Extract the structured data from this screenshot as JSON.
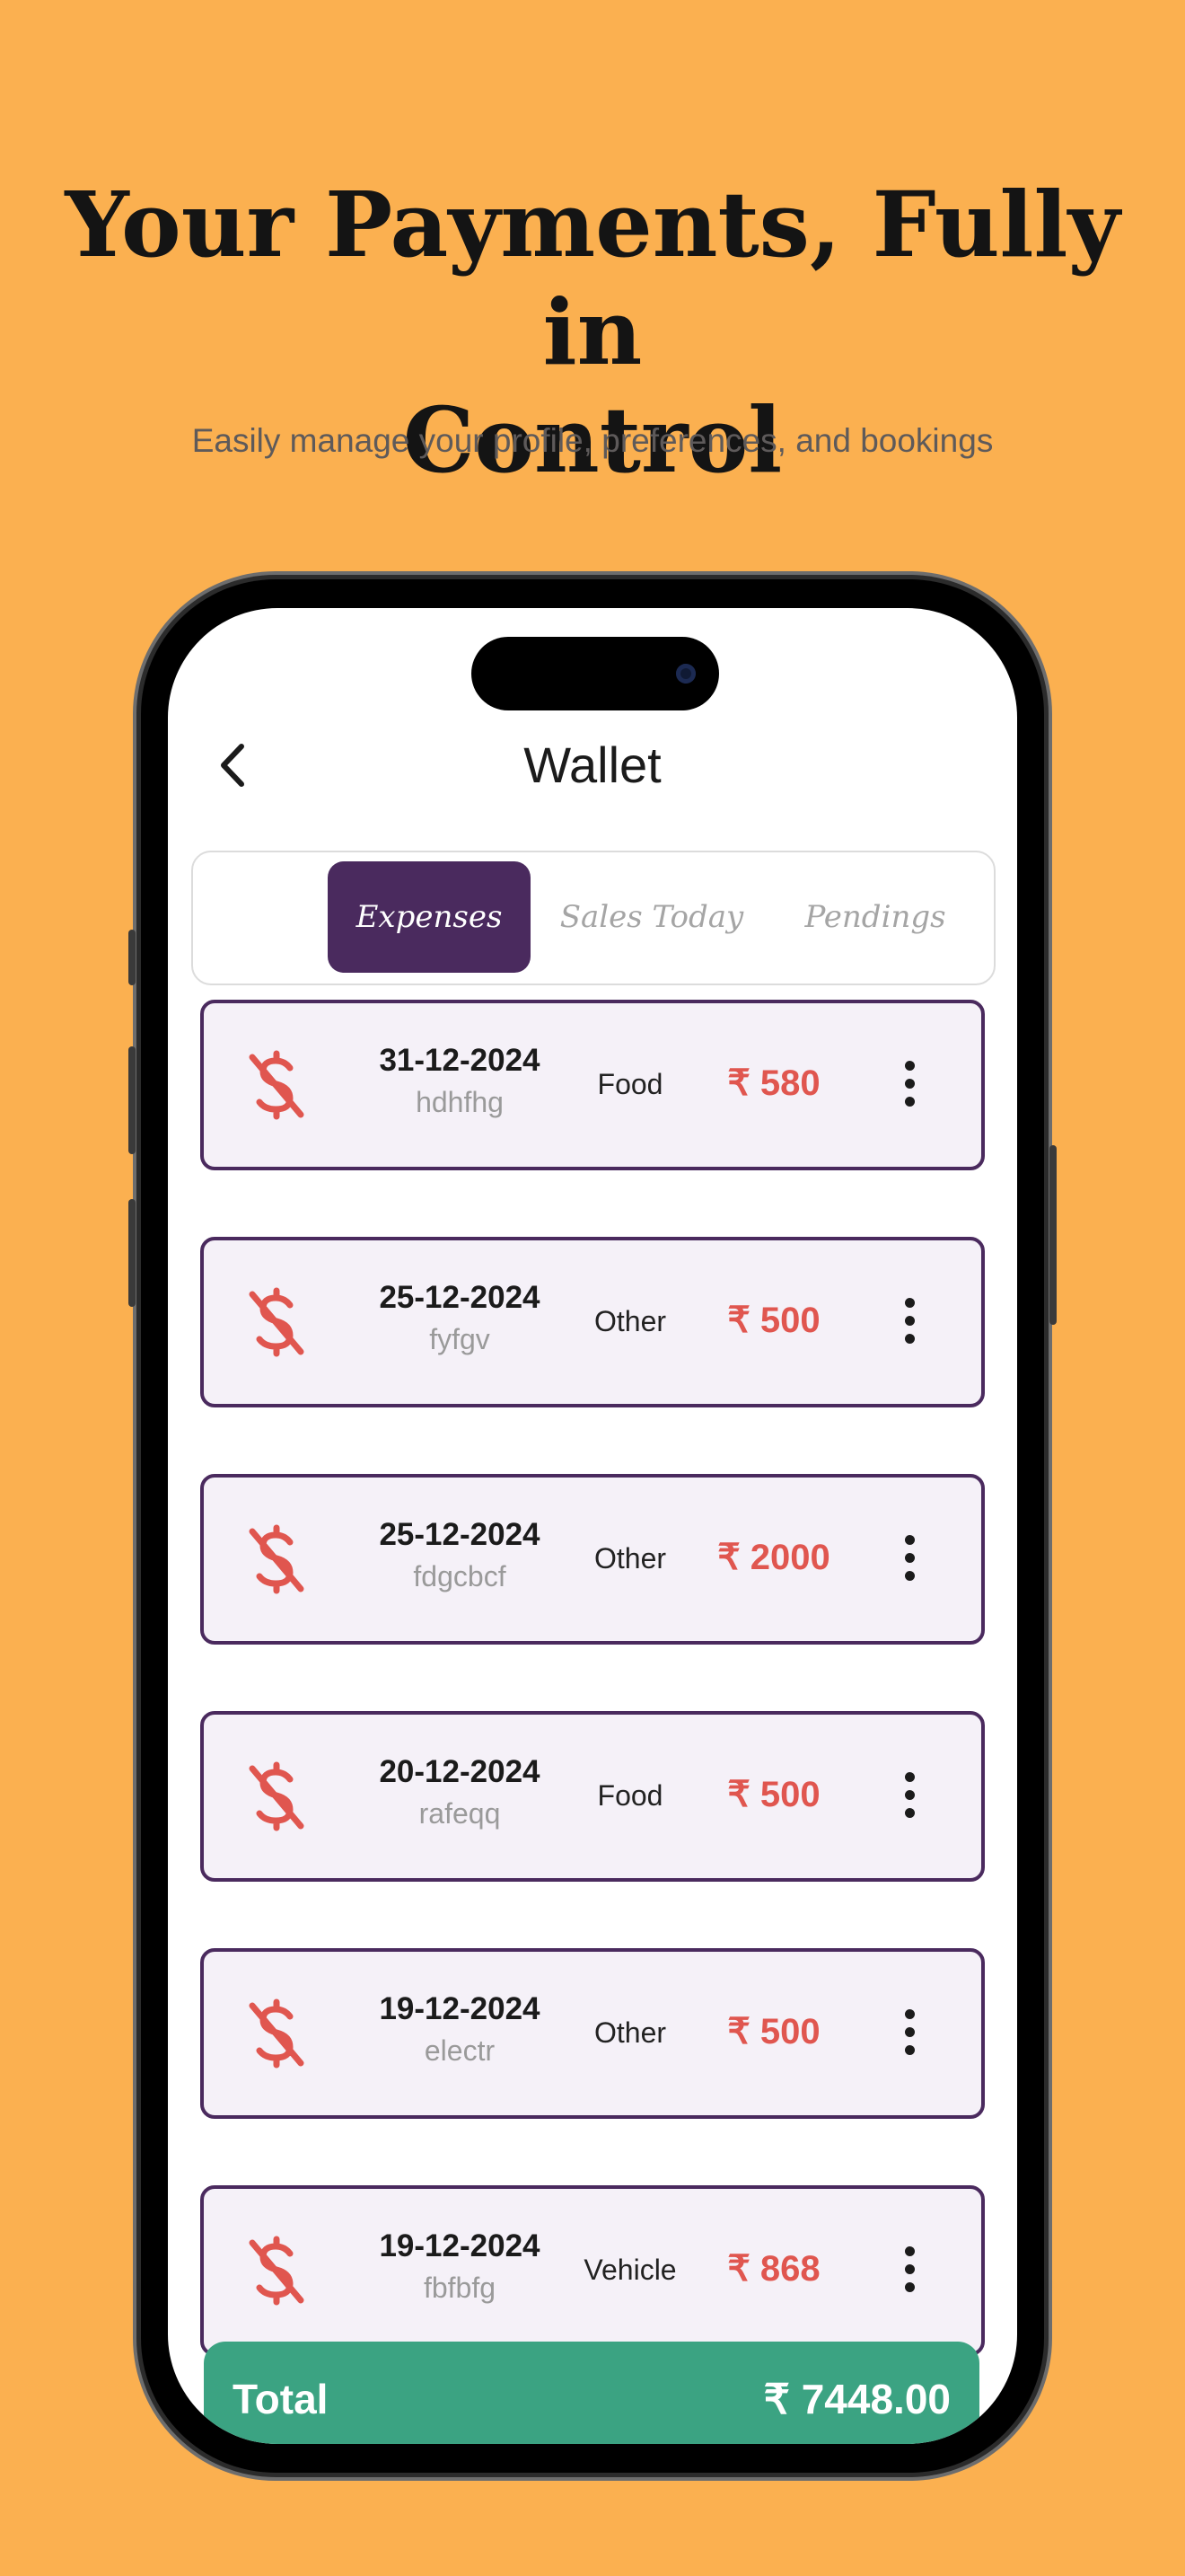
{
  "promo": {
    "headline_line1": "Your Payments, Fully in",
    "headline_line2": "Control",
    "subheadline": "Easily manage your profile, preferences, and bookings"
  },
  "app": {
    "title": "Wallet",
    "back_icon": "chevron-left-icon",
    "tabs": [
      {
        "label": "Expenses",
        "active": true
      },
      {
        "label": "Sales Today",
        "active": false
      },
      {
        "label": "Pendings",
        "active": false
      }
    ],
    "expenses": [
      {
        "date": "31-12-2024",
        "note": "hdhfhg",
        "category": "Food",
        "amount": "₹ 580"
      },
      {
        "date": "25-12-2024",
        "note": "fyfgv",
        "category": "Other",
        "amount": "₹ 500"
      },
      {
        "date": "25-12-2024",
        "note": "fdgcbcf",
        "category": "Other",
        "amount": "₹ 2000"
      },
      {
        "date": "20-12-2024",
        "note": "rafeqq",
        "category": "Food",
        "amount": "₹ 500"
      },
      {
        "date": "19-12-2024",
        "note": "electr",
        "category": "Other",
        "amount": "₹ 500"
      },
      {
        "date": "19-12-2024",
        "note": "fbfbfg",
        "category": "Vehicle",
        "amount": "₹ 868"
      }
    ],
    "total": {
      "label": "Total",
      "value": "₹ 7448.00"
    }
  },
  "colors": {
    "background": "#FBB050",
    "accent": "#4A2A5E",
    "amount": "#E0564F",
    "total_bar": "#3BA382"
  }
}
